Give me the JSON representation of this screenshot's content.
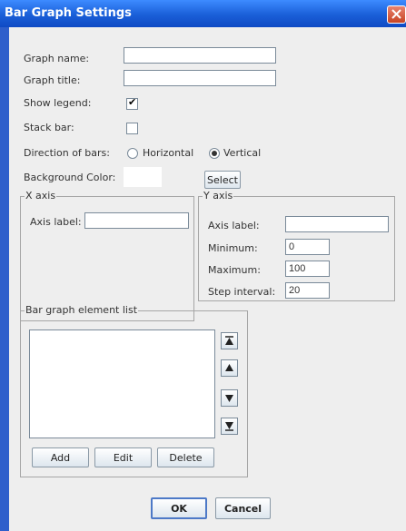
{
  "window": {
    "title": "Bar Graph Settings"
  },
  "form": {
    "graph_name_label": "Graph name:",
    "graph_name_value": "",
    "graph_title_label": "Graph title:",
    "graph_title_value": "",
    "show_legend_label": "Show legend:",
    "show_legend_checked": true,
    "stack_bar_label": "Stack bar:",
    "stack_bar_checked": false,
    "direction_label": "Direction of bars:",
    "direction_options": [
      "Horizontal",
      "Vertical"
    ],
    "direction_selected": "Vertical",
    "background_color_label": "Background Color:",
    "background_color_value": "#ffffff",
    "select_button": "Select"
  },
  "x_axis": {
    "group_label": "X axis",
    "axis_label_label": "Axis label:",
    "axis_label_value": ""
  },
  "y_axis": {
    "group_label": "Y axis",
    "axis_label_label": "Axis label:",
    "axis_label_value": "",
    "minimum_label": "Minimum:",
    "minimum_value": "0",
    "maximum_label": "Maximum:",
    "maximum_value": "100",
    "step_label": "Step interval:",
    "step_value": "20"
  },
  "element_list": {
    "group_label": "Bar graph element list",
    "items": [],
    "add_button": "Add",
    "edit_button": "Edit",
    "delete_button": "Delete"
  },
  "footer": {
    "ok_button": "OK",
    "cancel_button": "Cancel"
  },
  "icons": {
    "close": "close-icon",
    "move_top": "move-top-icon",
    "move_up": "move-up-icon",
    "move_down": "move-down-icon",
    "move_bottom": "move-bottom-icon",
    "check": "checkmark-icon"
  },
  "colors": {
    "title_bar": "#1a5fd8",
    "client_bg": "#eeeeee",
    "close_button": "#c74424"
  }
}
